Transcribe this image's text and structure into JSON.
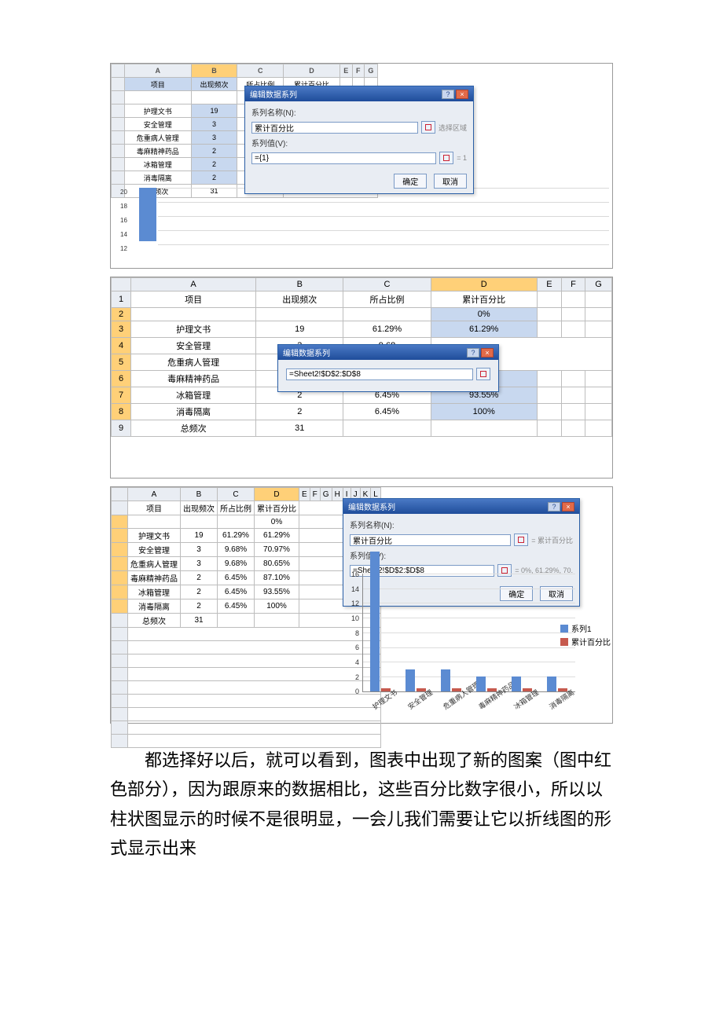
{
  "columns": [
    "A",
    "B",
    "C",
    "D",
    "E",
    "F",
    "G"
  ],
  "columns_wide": [
    "A",
    "B",
    "C",
    "D",
    "E",
    "F",
    "G",
    "H",
    "I",
    "J",
    "K",
    "L"
  ],
  "header_row": {
    "A": "项目",
    "B": "出现频次",
    "C": "所占比例",
    "D": "累计百分比"
  },
  "rows": [
    {
      "A": "护理文书",
      "B": "19",
      "C": "61.29%",
      "D": "61.29%"
    },
    {
      "A": "安全管理",
      "B": "3",
      "C": "9.68%",
      "D": "70.97%"
    },
    {
      "A": "危重病人管理",
      "B": "3",
      "C": "9.68%",
      "D": "80.65%"
    },
    {
      "A": "毒麻精神药品",
      "B": "2",
      "C": "6.45%",
      "D": "87.10%"
    },
    {
      "A": "冰箱管理",
      "B": "2",
      "C": "6.45%",
      "D": "93.55%"
    },
    {
      "A": "消毒隔离",
      "B": "2",
      "C": "6.45%",
      "D": "100%"
    }
  ],
  "total_row": {
    "A": "总频次",
    "B": "31"
  },
  "zero_percent": "0%",
  "partial_c": "9.68",
  "dialog": {
    "title": "编辑数据系列",
    "name_label": "系列名称(N):",
    "value_label": "系列值(V):",
    "name_value": "累计百分比",
    "name_preview_sel": "选择区域",
    "name_preview_eq": "= 累计百分比",
    "val_value1": "={1}",
    "val_preview1": "= 1",
    "val_value2": "=Sheet2!$D$2:$D$8",
    "val_preview2": "= 0%, 61.29%, 70.",
    "ok": "确定",
    "cancel": "取消"
  },
  "chart_data": {
    "type": "bar",
    "categories": [
      "护理文书",
      "安全管理",
      "危重病人管理",
      "毒麻精神药品",
      "冰箱管理",
      "消毒隔离"
    ],
    "series": [
      {
        "name": "系列1",
        "values": [
          19,
          3,
          3,
          2,
          2,
          2
        ],
        "color": "#5b8bd2"
      },
      {
        "name": "累计百分比",
        "values": [
          0.6129,
          0.7097,
          0.8065,
          0.871,
          0.9355,
          1.0
        ],
        "color": "#c65a4e"
      }
    ],
    "ylim": [
      0,
      20
    ],
    "yticks_shot1": [
      12,
      14,
      16,
      18,
      20
    ],
    "yticks_shot3": [
      0,
      2,
      4,
      6,
      8,
      10,
      12,
      14,
      16
    ]
  },
  "legend": {
    "s1": "系列1",
    "s2": "累计百分比"
  },
  "paragraph": "都选择好以后，就可以看到，图表中出现了新的图案（图中红色部分），因为跟原来的数据相比，这些百分比数字很小，所以以柱状图显示的时候不是很明显，一会儿我们需要让它以折线图的形式显示出来"
}
